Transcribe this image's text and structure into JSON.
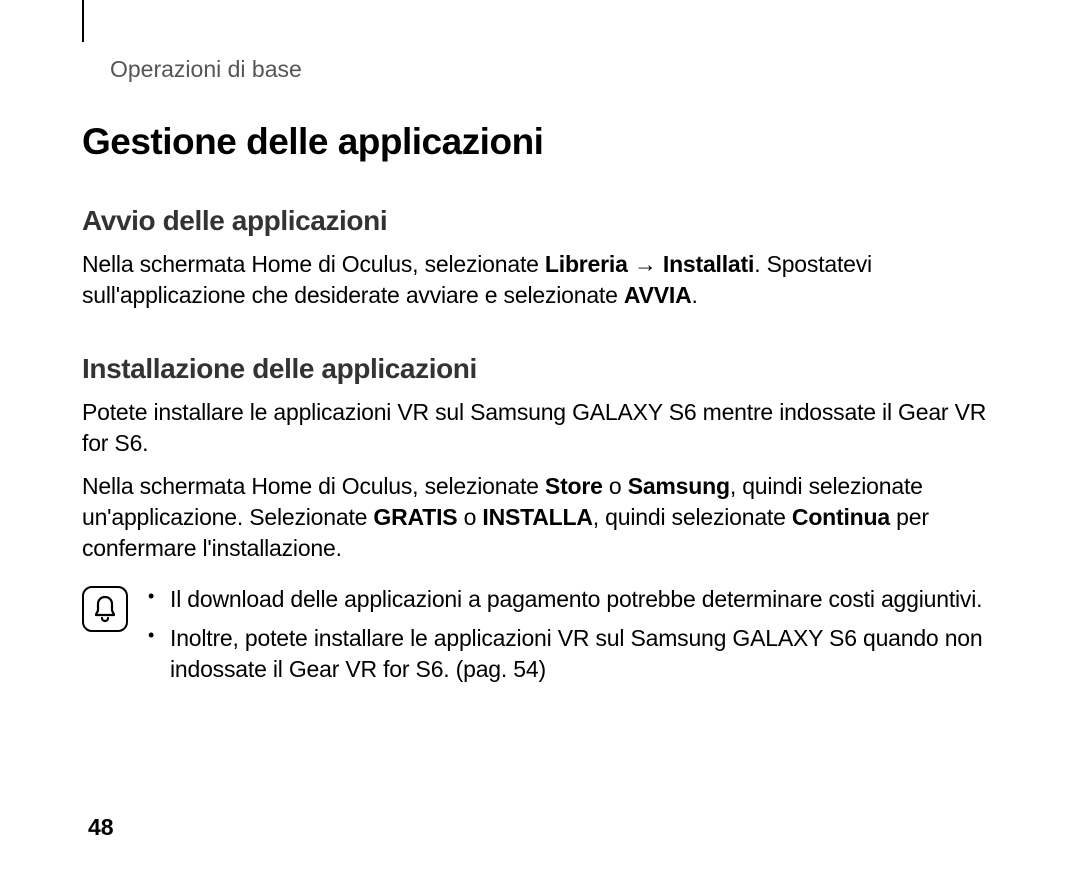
{
  "section_header": "Operazioni di base",
  "title": "Gestione delle applicazioni",
  "s1": {
    "heading": "Avvio delle applicazioni",
    "p1a": "Nella schermata Home di Oculus, selezionate ",
    "p1b": "Libreria",
    "arrow": " → ",
    "p1c": "Installati",
    "p1d": ". Spostatevi sull'applicazione che desiderate avviare e selezionate ",
    "p1e": "AVVIA",
    "p1f": "."
  },
  "s2": {
    "heading": "Installazione delle applicazioni",
    "p1": "Potete installare le applicazioni VR sul Samsung GALAXY S6 mentre indossate il Gear VR for S6.",
    "p2a": "Nella schermata Home di Oculus, selezionate ",
    "p2b": "Store",
    "p2c": " o ",
    "p2d": "Samsung",
    "p2e": ", quindi selezionate un'applicazione. Selezionate ",
    "p2f": "GRATIS",
    "p2g": " o ",
    "p2h": "INSTALLA",
    "p2i": ", quindi selezionate ",
    "p2j": "Continua",
    "p2k": " per confermare l'installazione."
  },
  "note": {
    "li1": "Il download delle applicazioni a pagamento potrebbe determinare costi aggiuntivi.",
    "li2": "Inoltre, potete installare le applicazioni VR sul Samsung GALAXY S6 quando non indossate il Gear VR for S6. (pag. 54)"
  },
  "page_number": "48"
}
